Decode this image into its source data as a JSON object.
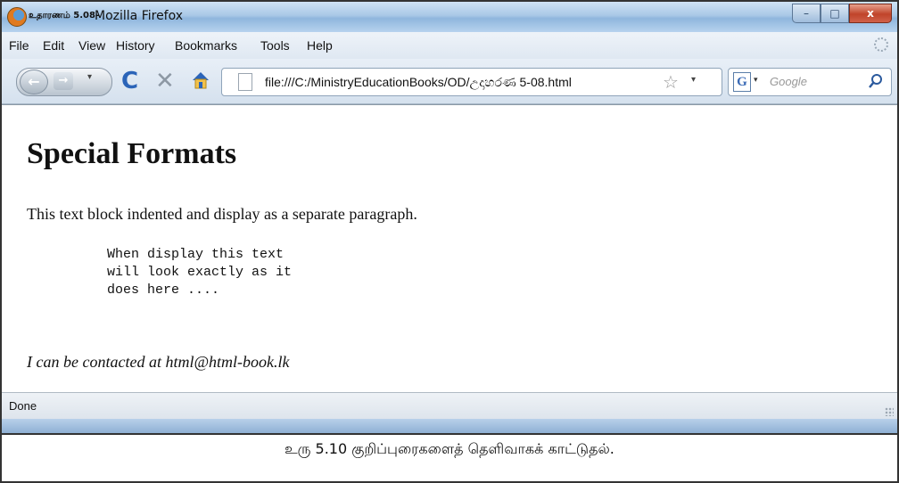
{
  "window": {
    "title_prefix": "உதாரணம் 5.08-",
    "title": "Mozilla Firefox",
    "controls": {
      "minimize": "–",
      "maximize": "□",
      "close": "x"
    }
  },
  "menu": {
    "items": [
      "File",
      "Edit",
      "View",
      "History",
      "Bookmarks",
      "Tools",
      "Help"
    ]
  },
  "nav": {
    "back_icon": "←",
    "forward_icon": "→",
    "dropdown_glyph": "▾",
    "reload_icon": "C",
    "stop_icon": "✕",
    "url": "file:///C:/MinistryEducationBooks/OD/උදාහරණ 5-08.html",
    "bookmark_star": "☆",
    "search_engine": "G",
    "search_placeholder": "Google"
  },
  "page": {
    "heading": "Special Formats",
    "paragraph": "This text block indented and display as a separate paragraph.",
    "pre_lines": [
      "When display this text",
      "will look exactly as it",
      "does here ...."
    ],
    "contact": "I can be contacted at html@html-book.lk"
  },
  "status": {
    "text": "Done"
  },
  "caption": "உரு 5.10 குறிப்புரைகளைத் தெளிவாகக் காட்டுதல்."
}
